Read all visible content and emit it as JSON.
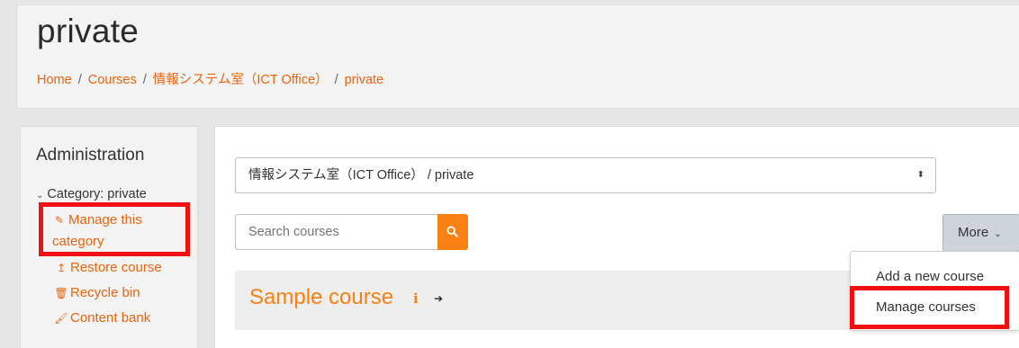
{
  "header": {
    "title": "private",
    "breadcrumb": [
      "Home",
      "Courses",
      "情報システム室（ICT Office）",
      "private"
    ],
    "separator": "/"
  },
  "admin": {
    "title": "Administration",
    "category_label": "Category: private",
    "items": [
      {
        "label": "Manage this category",
        "icon": "pencil-icon"
      },
      {
        "label": "Restore course",
        "icon": "restore-icon"
      },
      {
        "label": "Recycle bin",
        "icon": "trash-icon"
      },
      {
        "label": "Content bank",
        "icon": "brush-icon"
      }
    ]
  },
  "main": {
    "category_select": "情報システム室（ICT Office） / private",
    "search_placeholder": "Search courses",
    "more_label": "More",
    "course": {
      "name": "Sample course"
    }
  },
  "more_menu": {
    "items": [
      "Add a new course",
      "Manage courses"
    ]
  },
  "colors": {
    "accent": "#f98012",
    "link": "#e8650f",
    "highlight": "#ee1111"
  }
}
